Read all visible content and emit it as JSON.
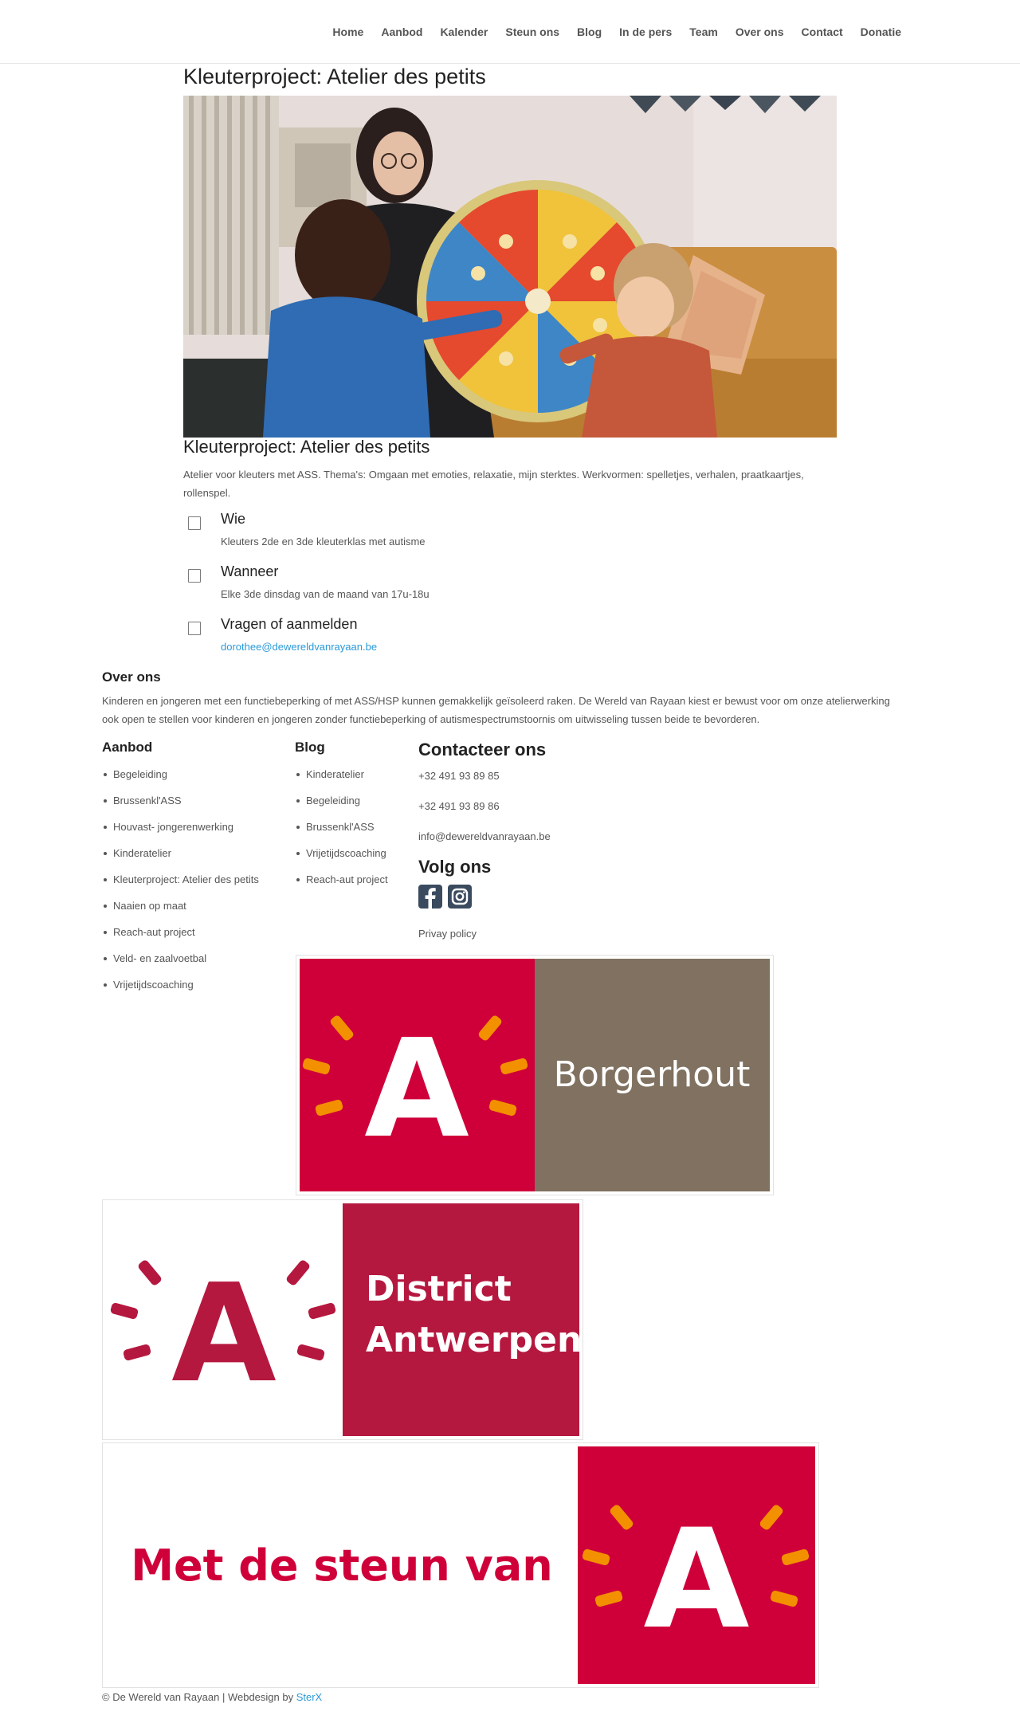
{
  "nav": {
    "items": [
      "Home",
      "Aanbod",
      "Kalender",
      "Steun ons",
      "Blog",
      "In de pers",
      "Team",
      "Over ons",
      "Contact",
      "Donatie"
    ]
  },
  "page": {
    "title": "Kleuterproject: Atelier des petits",
    "subtitle": "Kleuterproject: Atelier des petits",
    "intro": "Atelier voor kleuters met ASS. Thema's: Omgaan met emoties, relaxatie, mijn sterktes. Werkvormen: spelletjes, verhalen, praatkaartjes, rollenspel."
  },
  "info": [
    {
      "label": "Wie",
      "value": "Kleuters 2de en 3de kleuterklas met autisme"
    },
    {
      "label": "Wanneer",
      "value": "Elke 3de dinsdag van de maand van 17u-18u"
    },
    {
      "label": "Vragen of aanmelden",
      "value": "dorothee@dewereldvanrayaan.be"
    }
  ],
  "about": {
    "title": "Over ons",
    "text": "Kinderen en jongeren met een functiebeperking of met ASS/HSP kunnen gemakkelijk geïsoleerd raken. De Wereld van Rayaan kiest er bewust voor om onze atelierwerking ook open te stellen voor kinderen en jongeren zonder functiebeperking of autismespectrumstoornis om uitwisseling tussen beide te bevorderen."
  },
  "aanbod": {
    "title": "Aanbod",
    "items": [
      "Begeleiding",
      "Brussenkl'ASS",
      "Houvast- jongerenwerking",
      "Kinderatelier",
      "Kleuterproject: Atelier des petits",
      "Naaien op maat",
      "Reach-aut project",
      "Veld- en zaalvoetbal",
      "Vrijetijdscoaching"
    ]
  },
  "blog": {
    "title": "Blog",
    "items": [
      "Kinderatelier",
      "Begeleiding",
      "Brussenkl'ASS",
      "Vrijetijdscoaching",
      "Reach-aut project"
    ]
  },
  "contact": {
    "title": "Contacteer ons",
    "phone1": "+32 491 93 89 85",
    "phone2": "+32 491 93 89 86",
    "email": "info@dewereldvanrayaan.be"
  },
  "follow": {
    "title": "Volg ons",
    "icons": [
      "facebook-icon",
      "instagram-icon"
    ],
    "privacy": "Privay policy"
  },
  "logos": {
    "borgerhout": "Borgerhout",
    "district_line1": "District",
    "district_line2": "Antwerpen",
    "steun": "Met de steun van",
    "mark_letter": "A"
  },
  "footer": {
    "copyright": "© De Wereld van Rayaan | Webdesign by ",
    "credit": "SterX"
  },
  "colors": {
    "antwerp_red": "#cf0039",
    "district_red": "#b5183f",
    "borgerhout_brown": "#807160",
    "ray_orange": "#f39000",
    "link_blue": "#2a9ad8"
  }
}
